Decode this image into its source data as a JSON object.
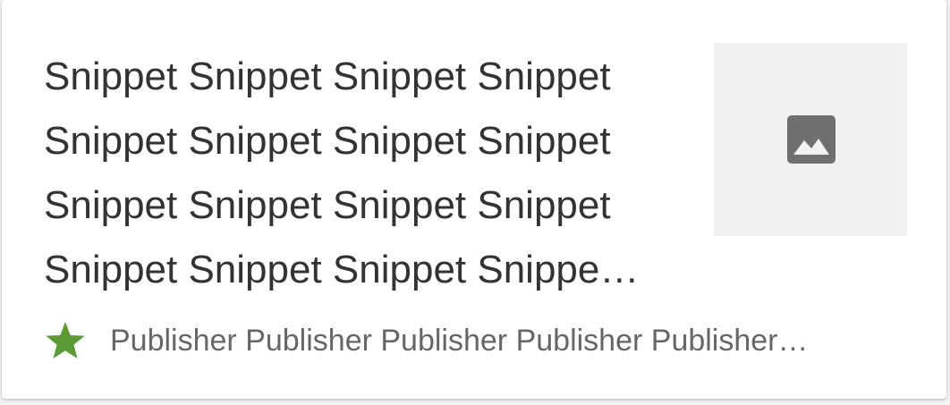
{
  "card": {
    "snippet_lines": [
      "Snippet Snippet Snippet Snippet",
      "Snippet Snippet Snippet Snippet",
      "Snippet Snippet Snippet Snippet",
      "Snippet Snippet Snippet Snippe…"
    ],
    "publisher": "Publisher Publisher Publisher Publisher Publisher…",
    "thumbnail_icon": "image-placeholder-icon",
    "publisher_icon": "star-icon"
  },
  "colors": {
    "star": "#5b9a35",
    "snippet_text": "#333333",
    "publisher_text": "#666666",
    "thumbnail_bg": "#f1f1f1",
    "icon": "#6f6f6f"
  }
}
